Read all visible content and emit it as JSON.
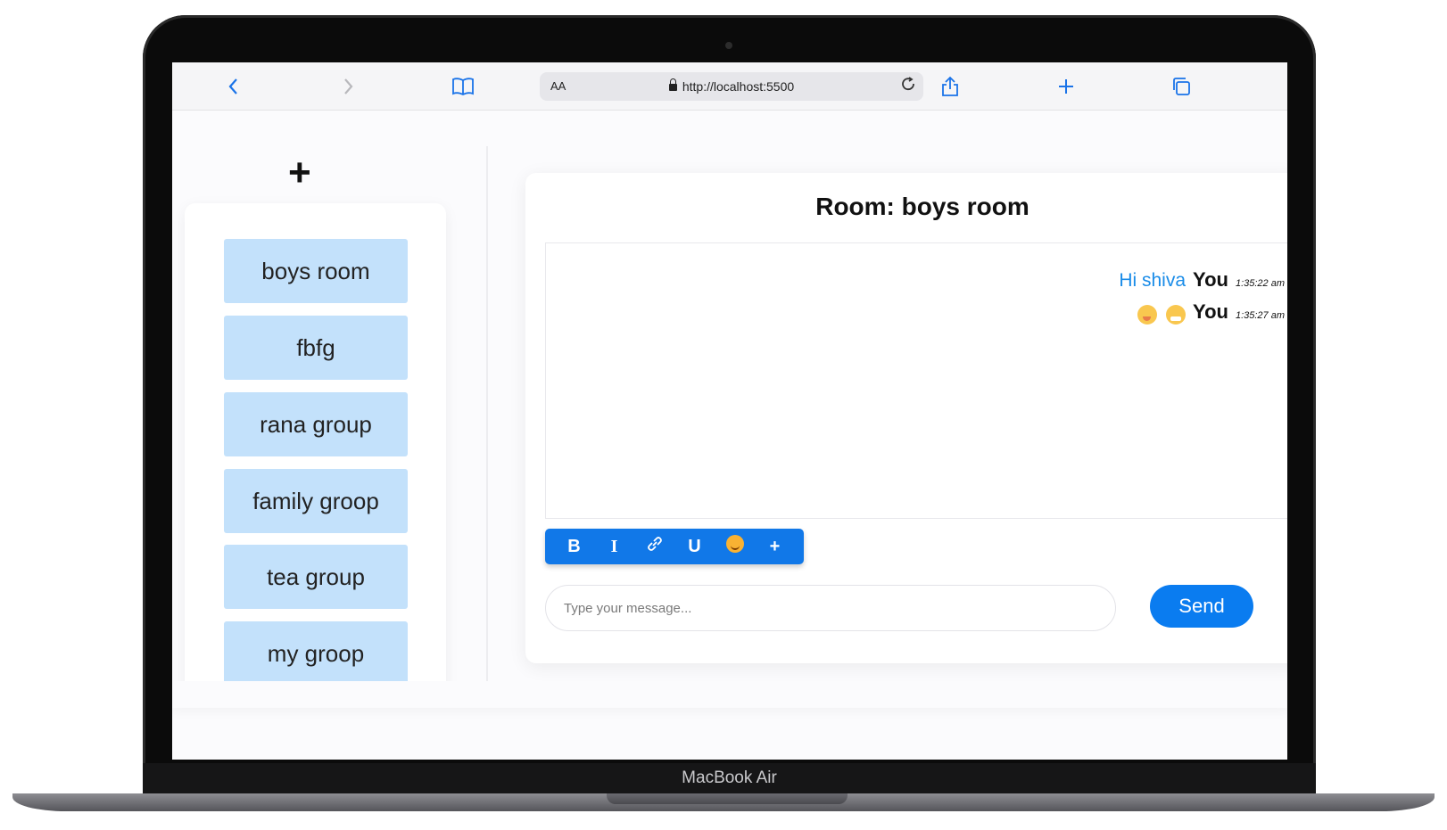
{
  "browser": {
    "url_prefix": "AA",
    "url": "http://localhost:5500"
  },
  "icons": {
    "back": "chevron-left-icon",
    "forward": "chevron-right-icon",
    "bookmarks": "book-icon",
    "reload": "reload-icon",
    "share": "share-icon",
    "new_tab": "plus-icon",
    "tabs": "tabs-icon"
  },
  "sidebar": {
    "add_label": "+",
    "rooms": [
      {
        "name": "boys room"
      },
      {
        "name": "fbfg"
      },
      {
        "name": "rana group"
      },
      {
        "name": "family groop"
      },
      {
        "name": "tea group"
      },
      {
        "name": "my groop"
      }
    ]
  },
  "chat": {
    "title": "Room: boys room",
    "messages": [
      {
        "text": "Hi shiva",
        "sender": "You",
        "time": "1:35:22 am"
      },
      {
        "text": "",
        "sender": "You",
        "time": "1:35:27 am"
      }
    ],
    "toolbar": {
      "bold": "B",
      "italic": "I",
      "underline": "U",
      "more": "+"
    },
    "input_placeholder": "Type your message...",
    "send_label": "Send"
  },
  "device": {
    "label": "MacBook Air"
  },
  "colors": {
    "accent": "#0a7cf0",
    "room_item": "#c3e1fb",
    "message_text": "#1a8ce8"
  }
}
